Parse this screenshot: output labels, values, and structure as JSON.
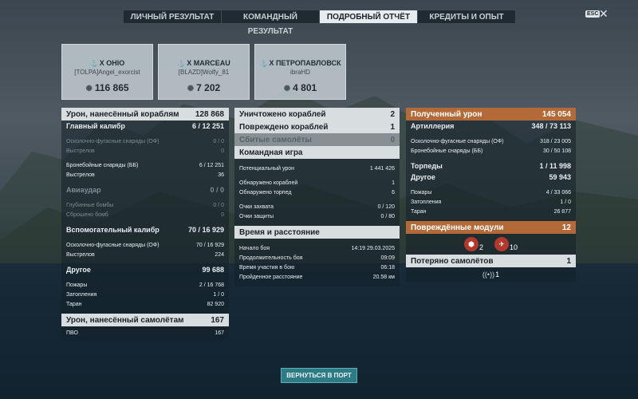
{
  "tabs": [
    "ЛИЧНЫЙ РЕЗУЛЬТАТ",
    "КОМАНДНЫЙ РЕЗУЛЬТАТ",
    "ПОДРОБНЫЙ ОТЧЁТ",
    "КРЕДИТЫ И ОПЫТ"
  ],
  "esc_label": "ESC",
  "close_glyph": "✕",
  "ships": [
    {
      "tier_icon": "⚓",
      "name": "X OHIO",
      "player": "[TOLPA]Angel_exorcist",
      "damage": "116 865"
    },
    {
      "tier_icon": "⚓",
      "name": "X MARCEAU",
      "player": "[BLAZD]Wolfy_81",
      "damage": "7 202"
    },
    {
      "tier_icon": "⚓",
      "name": "X ПЕТРОПАВЛОВСК",
      "player": "ibraHD",
      "damage": "4 801"
    }
  ],
  "left": {
    "ship_damage": {
      "label": "Урон, нанесённый кораблям",
      "value": "128 868"
    },
    "main_caliber": {
      "label": "Главный калибр",
      "value": "6 / 12 251"
    },
    "he": {
      "label": "Осколочно-фугасные снаряды (ОФ)",
      "value": "0 / 0"
    },
    "he_shots": {
      "label": "Выстрелов",
      "value": "0"
    },
    "ap": {
      "label": "Бронебойные снаряды (ББ)",
      "value": "6 / 12 251"
    },
    "ap_shots": {
      "label": "Выстрелов",
      "value": "36"
    },
    "airstrike": {
      "label": "Авиаудар",
      "value": "0 / 0"
    },
    "depth": {
      "label": "Глубинные бомбы",
      "value": "0 / 0"
    },
    "depth_dropped": {
      "label": "Сброшено бомб",
      "value": "0"
    },
    "secondary": {
      "label": "Вспомогательный калибр",
      "value": "70 / 16 929"
    },
    "sec_he": {
      "label": "Осколочно-фугасные снаряды (ОФ)",
      "value": "70 / 16 929"
    },
    "sec_shots": {
      "label": "Выстрелов",
      "value": "224"
    },
    "other": {
      "label": "Другое",
      "value": "99 688"
    },
    "fires": {
      "label": "Пожары",
      "value": "2 / 16 768"
    },
    "floods": {
      "label": "Затопления",
      "value": "1 / 0"
    },
    "ram": {
      "label": "Таран",
      "value": "82 920"
    },
    "plane_damage": {
      "label": "Урон, нанесённый самолётам",
      "value": "167"
    },
    "aa": {
      "label": "ПВО",
      "value": "167"
    }
  },
  "middle": {
    "destroyed": {
      "label": "Уничтожено кораблей",
      "value": "2"
    },
    "damaged": {
      "label": "Повреждено кораблей",
      "value": "1"
    },
    "planes_shot": {
      "label": "Сбитые самолёты",
      "value": "0"
    },
    "team_title": "Командная игра",
    "potential": {
      "label": "Потенциальный урон",
      "value": "1 441 426"
    },
    "spotted": {
      "label": "Обнаружено кораблей",
      "value": "1"
    },
    "torps_spotted": {
      "label": "Обнаружено торпед",
      "value": "6"
    },
    "capture": {
      "label": "Очки захвата",
      "value": "0 / 120"
    },
    "defense": {
      "label": "Очки защиты",
      "value": "0 / 80"
    },
    "time_title": "Время и расстояние",
    "start": {
      "label": "Начало боя",
      "value": "14:19  29.03.2025"
    },
    "duration": {
      "label": "Продолжительность боя",
      "value": "09:09"
    },
    "participation": {
      "label": "Время участия в бою",
      "value": "06:18"
    },
    "distance": {
      "label": "Пройденное расстояние",
      "value": "20.58 км"
    }
  },
  "right": {
    "received": {
      "label": "Полученный урон",
      "value": "145 054"
    },
    "artillery": {
      "label": "Артиллерия",
      "value": "348 / 73 113"
    },
    "r_he": {
      "label": "Осколочно-фугасные снаряды (ОФ)",
      "value": "318 / 23 005"
    },
    "r_ap": {
      "label": "Бронебойные снаряды (ББ)",
      "value": "30 / 50 108"
    },
    "torpedoes": {
      "label": "Торпеды",
      "value": "1 / 11 998"
    },
    "r_other": {
      "label": "Другое",
      "value": "59 943"
    },
    "r_fires": {
      "label": "Пожары",
      "value": "4 / 33 066"
    },
    "r_floods": {
      "label": "Затопления",
      "value": "1 / 0"
    },
    "r_ram": {
      "label": "Таран",
      "value": "26 877"
    },
    "modules": {
      "label": "Повреждённые модули",
      "value": "12"
    },
    "module_icons": [
      {
        "icon": "turret-icon",
        "count": "2"
      },
      {
        "icon": "steering-icon",
        "count": "10"
      }
    ],
    "planes_lost": {
      "label": "Потеряно самолётов",
      "value": "1"
    },
    "planes_lost_icon_count": "1"
  },
  "back_button": "ВЕРНУТЬСЯ В ПОРТ",
  "colors": {
    "accent_orange": "#b46a38",
    "header_light": "#d8dde0",
    "button": "#2e7b86"
  }
}
